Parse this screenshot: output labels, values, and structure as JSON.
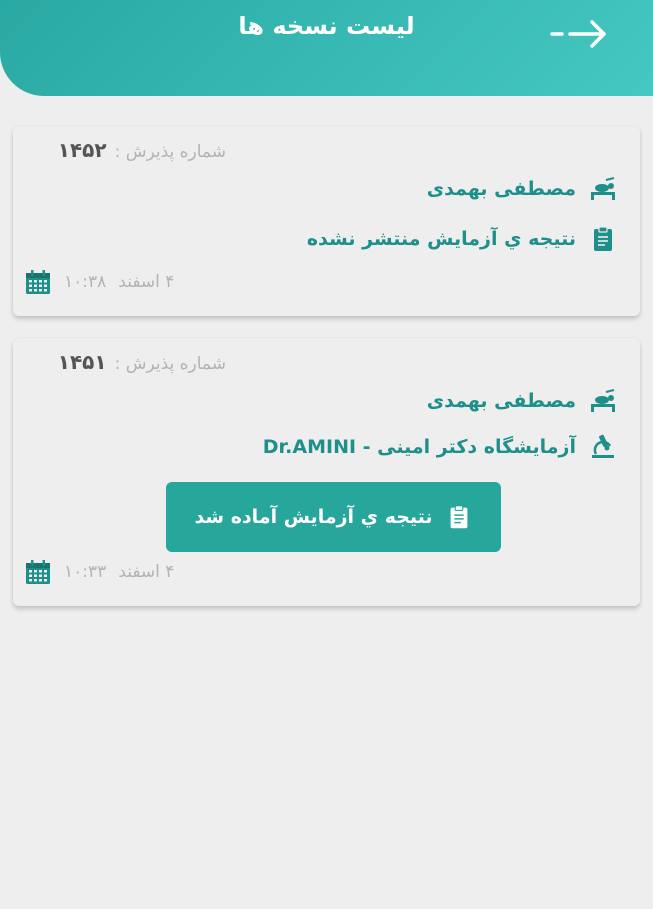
{
  "header": {
    "title": "لیست نسخه ها",
    "back_icon": "arrow-right-icon"
  },
  "colors": {
    "header": "#35b8b2",
    "accent_text": "#1e8f8a",
    "button": "#27a69c",
    "muted": "#b3b3b3"
  },
  "prescriptions": [
    {
      "reception_label": "شماره پذیرش :",
      "reception_number": "۱۴۵۲",
      "patient_name": "مصطفی بهمدی",
      "status_text": "نتیجه ي آزمایش منتشر نشده",
      "date": "۴ اسفند",
      "time": "۱۰:۳۸"
    },
    {
      "reception_label": "شماره پذیرش :",
      "reception_number": "۱۴۵۱",
      "patient_name": "مصطفی بهمدی",
      "lab_name": "آزمایشگاه دکتر امینی - Dr.AMINI",
      "result_button_label": "نتیجه ي آزمایش آماده شد",
      "date": "۴ اسفند",
      "time": "۱۰:۳۳"
    }
  ]
}
